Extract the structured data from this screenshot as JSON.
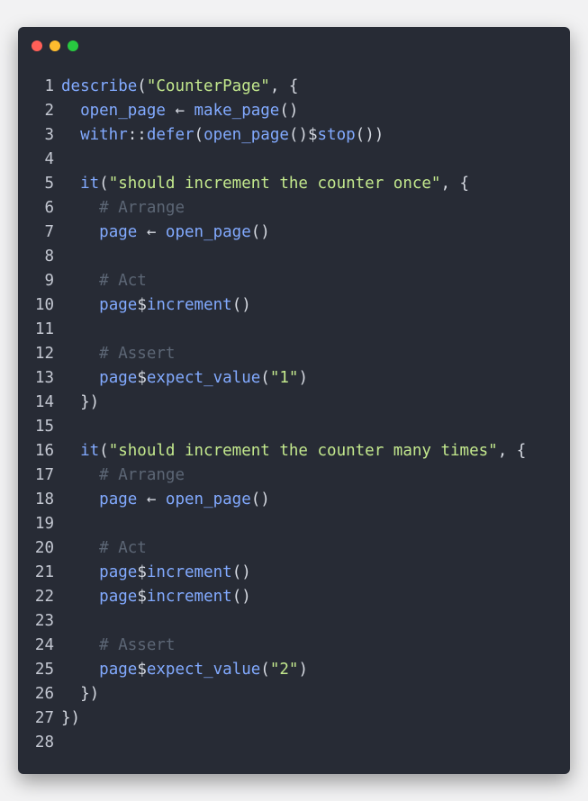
{
  "window": {
    "colors": {
      "background": "#272b35",
      "close": "#ff5f57",
      "minimize": "#febc2e",
      "maximize": "#28c840"
    }
  },
  "code": {
    "lines": [
      [
        {
          "t": "describe",
          "c": "t-fn"
        },
        {
          "t": "(",
          "c": "t-plain"
        },
        {
          "t": "\"CounterPage\"",
          "c": "t-str"
        },
        {
          "t": ", {",
          "c": "t-plain"
        }
      ],
      [
        {
          "t": "  ",
          "c": "t-plain"
        },
        {
          "t": "open_page",
          "c": "t-fn"
        },
        {
          "t": " ← ",
          "c": "t-op"
        },
        {
          "t": "make_page",
          "c": "t-fn"
        },
        {
          "t": "()",
          "c": "t-plain"
        }
      ],
      [
        {
          "t": "  ",
          "c": "t-plain"
        },
        {
          "t": "withr",
          "c": "t-fn"
        },
        {
          "t": "::",
          "c": "t-plain"
        },
        {
          "t": "defer",
          "c": "t-fn"
        },
        {
          "t": "(",
          "c": "t-plain"
        },
        {
          "t": "open_page",
          "c": "t-fn"
        },
        {
          "t": "()$",
          "c": "t-plain"
        },
        {
          "t": "stop",
          "c": "t-fn"
        },
        {
          "t": "())",
          "c": "t-plain"
        }
      ],
      [],
      [
        {
          "t": "  ",
          "c": "t-plain"
        },
        {
          "t": "it",
          "c": "t-fn"
        },
        {
          "t": "(",
          "c": "t-plain"
        },
        {
          "t": "\"should increment the counter once\"",
          "c": "t-str"
        },
        {
          "t": ", {",
          "c": "t-plain"
        }
      ],
      [
        {
          "t": "    ",
          "c": "t-plain"
        },
        {
          "t": "# Arrange",
          "c": "t-com"
        }
      ],
      [
        {
          "t": "    ",
          "c": "t-plain"
        },
        {
          "t": "page",
          "c": "t-fn"
        },
        {
          "t": " ← ",
          "c": "t-op"
        },
        {
          "t": "open_page",
          "c": "t-fn"
        },
        {
          "t": "()",
          "c": "t-plain"
        }
      ],
      [],
      [
        {
          "t": "    ",
          "c": "t-plain"
        },
        {
          "t": "# Act",
          "c": "t-com"
        }
      ],
      [
        {
          "t": "    ",
          "c": "t-plain"
        },
        {
          "t": "page",
          "c": "t-fn"
        },
        {
          "t": "$",
          "c": "t-plain"
        },
        {
          "t": "increment",
          "c": "t-fn"
        },
        {
          "t": "()",
          "c": "t-plain"
        }
      ],
      [],
      [
        {
          "t": "    ",
          "c": "t-plain"
        },
        {
          "t": "# Assert",
          "c": "t-com"
        }
      ],
      [
        {
          "t": "    ",
          "c": "t-plain"
        },
        {
          "t": "page",
          "c": "t-fn"
        },
        {
          "t": "$",
          "c": "t-plain"
        },
        {
          "t": "expect_value",
          "c": "t-fn"
        },
        {
          "t": "(",
          "c": "t-plain"
        },
        {
          "t": "\"1\"",
          "c": "t-str"
        },
        {
          "t": ")",
          "c": "t-plain"
        }
      ],
      [
        {
          "t": "  })",
          "c": "t-plain"
        }
      ],
      [],
      [
        {
          "t": "  ",
          "c": "t-plain"
        },
        {
          "t": "it",
          "c": "t-fn"
        },
        {
          "t": "(",
          "c": "t-plain"
        },
        {
          "t": "\"should increment the counter many times\"",
          "c": "t-str"
        },
        {
          "t": ", {",
          "c": "t-plain"
        }
      ],
      [
        {
          "t": "    ",
          "c": "t-plain"
        },
        {
          "t": "# Arrange",
          "c": "t-com"
        }
      ],
      [
        {
          "t": "    ",
          "c": "t-plain"
        },
        {
          "t": "page",
          "c": "t-fn"
        },
        {
          "t": " ← ",
          "c": "t-op"
        },
        {
          "t": "open_page",
          "c": "t-fn"
        },
        {
          "t": "()",
          "c": "t-plain"
        }
      ],
      [],
      [
        {
          "t": "    ",
          "c": "t-plain"
        },
        {
          "t": "# Act",
          "c": "t-com"
        }
      ],
      [
        {
          "t": "    ",
          "c": "t-plain"
        },
        {
          "t": "page",
          "c": "t-fn"
        },
        {
          "t": "$",
          "c": "t-plain"
        },
        {
          "t": "increment",
          "c": "t-fn"
        },
        {
          "t": "()",
          "c": "t-plain"
        }
      ],
      [
        {
          "t": "    ",
          "c": "t-plain"
        },
        {
          "t": "page",
          "c": "t-fn"
        },
        {
          "t": "$",
          "c": "t-plain"
        },
        {
          "t": "increment",
          "c": "t-fn"
        },
        {
          "t": "()",
          "c": "t-plain"
        }
      ],
      [],
      [
        {
          "t": "    ",
          "c": "t-plain"
        },
        {
          "t": "# Assert",
          "c": "t-com"
        }
      ],
      [
        {
          "t": "    ",
          "c": "t-plain"
        },
        {
          "t": "page",
          "c": "t-fn"
        },
        {
          "t": "$",
          "c": "t-plain"
        },
        {
          "t": "expect_value",
          "c": "t-fn"
        },
        {
          "t": "(",
          "c": "t-plain"
        },
        {
          "t": "\"2\"",
          "c": "t-str"
        },
        {
          "t": ")",
          "c": "t-plain"
        }
      ],
      [
        {
          "t": "  })",
          "c": "t-plain"
        }
      ],
      [
        {
          "t": "})",
          "c": "t-plain"
        }
      ],
      []
    ]
  }
}
